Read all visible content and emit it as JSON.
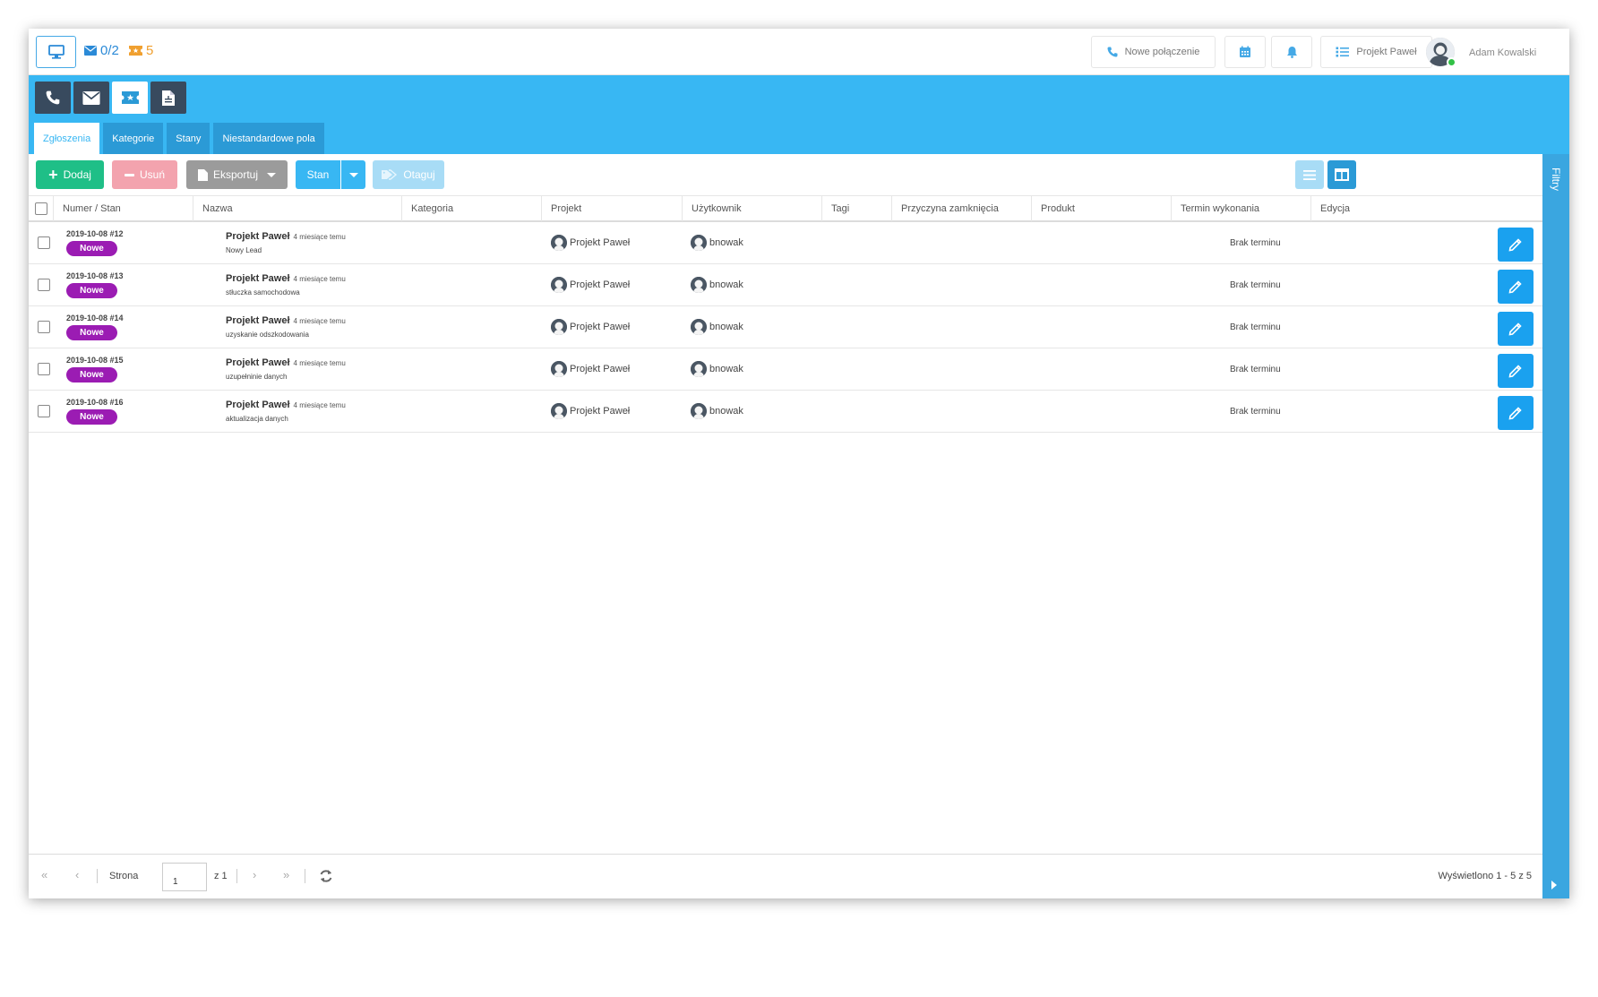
{
  "topbar": {
    "mail_count": "0/2",
    "ticket_count": "5",
    "new_call_label": "Nowe połączenie",
    "project_label": "Projekt Paweł",
    "user_name": "Adam Kowalski"
  },
  "tabs": [
    {
      "label": "Zgłoszenia",
      "active": true
    },
    {
      "label": "Kategorie",
      "active": false
    },
    {
      "label": "Stany",
      "active": false
    },
    {
      "label": "Niestandardowe pola",
      "active": false
    }
  ],
  "toolbar": {
    "add_label": "Dodaj",
    "delete_label": "Usuń",
    "export_label": "Eksportuj",
    "state_label": "Stan",
    "tag_label": "Otaguj"
  },
  "table": {
    "columns": [
      "Numer / Stan",
      "Nazwa",
      "Kategoria",
      "Projekt",
      "Użytkownik",
      "Tagi",
      "Przyczyna zamknięcia",
      "Produkt",
      "Termin wykonania",
      "Edycja"
    ],
    "rows": [
      {
        "number": "2019-10-08 #12",
        "status": "Nowe",
        "title": "Projekt Paweł",
        "ago": "4 miesiące temu",
        "subject": "Nowy Lead",
        "category": "",
        "project": "Projekt Paweł",
        "user": "bnowak",
        "tags": "",
        "close_reason": "",
        "product": "",
        "due": "Brak terminu"
      },
      {
        "number": "2019-10-08 #13",
        "status": "Nowe",
        "title": "Projekt Paweł",
        "ago": "4 miesiące temu",
        "subject": "stłuczka samochodowa",
        "category": "",
        "project": "Projekt Paweł",
        "user": "bnowak",
        "tags": "",
        "close_reason": "",
        "product": "",
        "due": "Brak terminu"
      },
      {
        "number": "2019-10-08 #14",
        "status": "Nowe",
        "title": "Projekt Paweł",
        "ago": "4 miesiące temu",
        "subject": "uzyskanie odszkodowania",
        "category": "",
        "project": "Projekt Paweł",
        "user": "bnowak",
        "tags": "",
        "close_reason": "",
        "product": "",
        "due": "Brak terminu"
      },
      {
        "number": "2019-10-08 #15",
        "status": "Nowe",
        "title": "Projekt Paweł",
        "ago": "4 miesiące temu",
        "subject": "uzupełninie danych",
        "category": "",
        "project": "Projekt Paweł",
        "user": "bnowak",
        "tags": "",
        "close_reason": "",
        "product": "",
        "due": "Brak terminu"
      },
      {
        "number": "2019-10-08 #16",
        "status": "Nowe",
        "title": "Projekt Paweł",
        "ago": "4 miesiące temu",
        "subject": "aktualizacja danych",
        "category": "",
        "project": "Projekt Paweł",
        "user": "bnowak",
        "tags": "",
        "close_reason": "",
        "product": "",
        "due": "Brak terminu"
      }
    ]
  },
  "pagination": {
    "page_label": "Strona",
    "page_value": "1",
    "of_label": "z 1",
    "shown_label": "Wyświetlono 1 - 5 z 5"
  },
  "filters": {
    "label": "Filtry"
  },
  "colors": {
    "accent": "#38b7f3",
    "module_dark": "#384a5e",
    "add_green": "#1fbf87",
    "status_purple": "#9b1cb3",
    "edit_blue": "#1aa1ef"
  }
}
